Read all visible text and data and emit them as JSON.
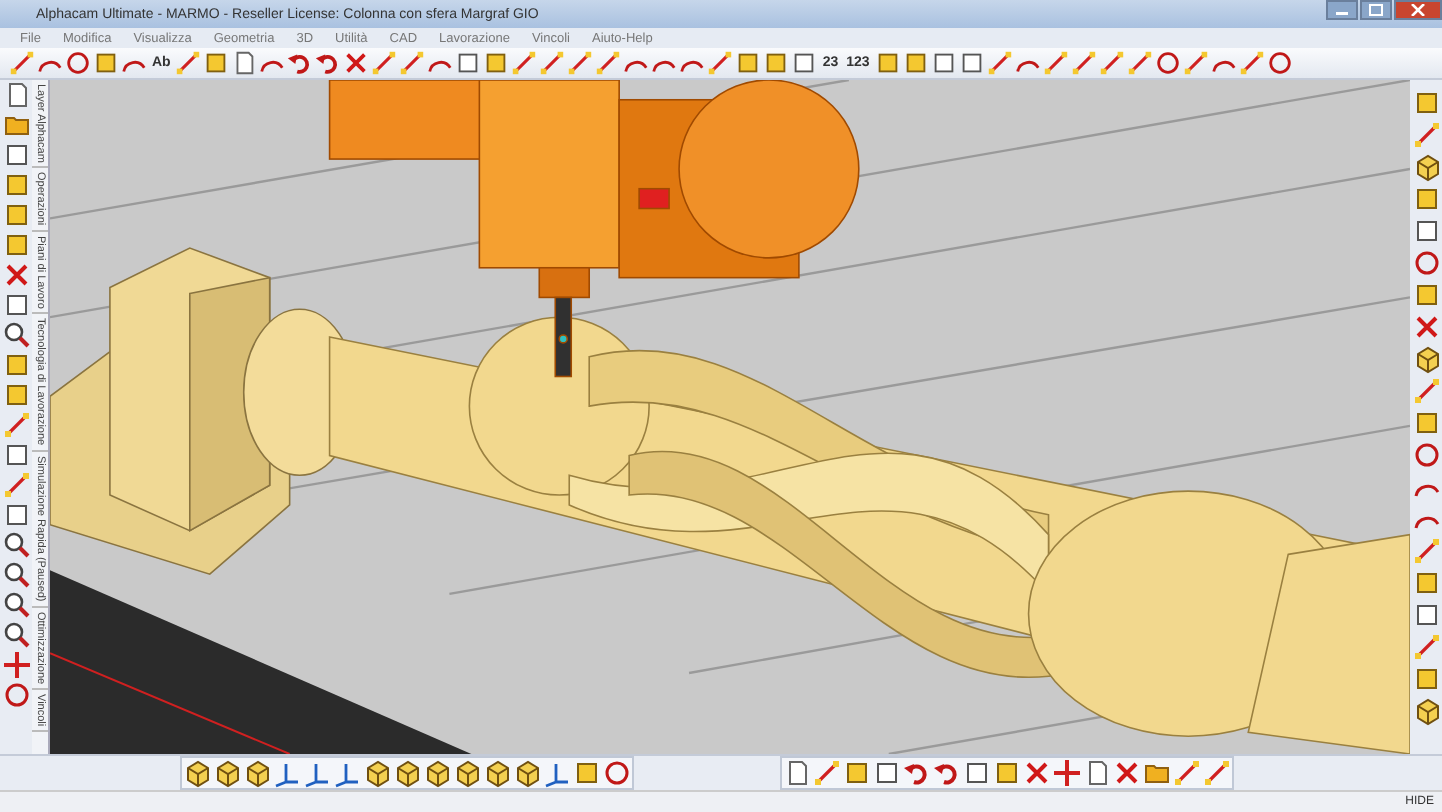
{
  "window": {
    "title": "Alphacam Ultimate - MARMO - Reseller License: Colonna con sfera Margraf GIO"
  },
  "menu": [
    "File",
    "Modifica",
    "Visualizza",
    "Geometria",
    "3D",
    "Utilità",
    "CAD",
    "Lavorazione",
    "Vincoli",
    "Aiuto-Help"
  ],
  "toolbar": {
    "labels": [
      "Ab",
      "23",
      "123"
    ]
  },
  "side_tabs": [
    {
      "label": "Layer Alphacam"
    },
    {
      "label": "Operazioni"
    },
    {
      "label": "Piani di Lavoro"
    },
    {
      "label": "Tecnologia di Lavorazione"
    },
    {
      "label": "Simulazione Rapida (Paused)"
    },
    {
      "label": "Ottimizzazione"
    },
    {
      "label": "Vincoli"
    }
  ],
  "status_bar": {
    "indicator": "HIDE"
  }
}
